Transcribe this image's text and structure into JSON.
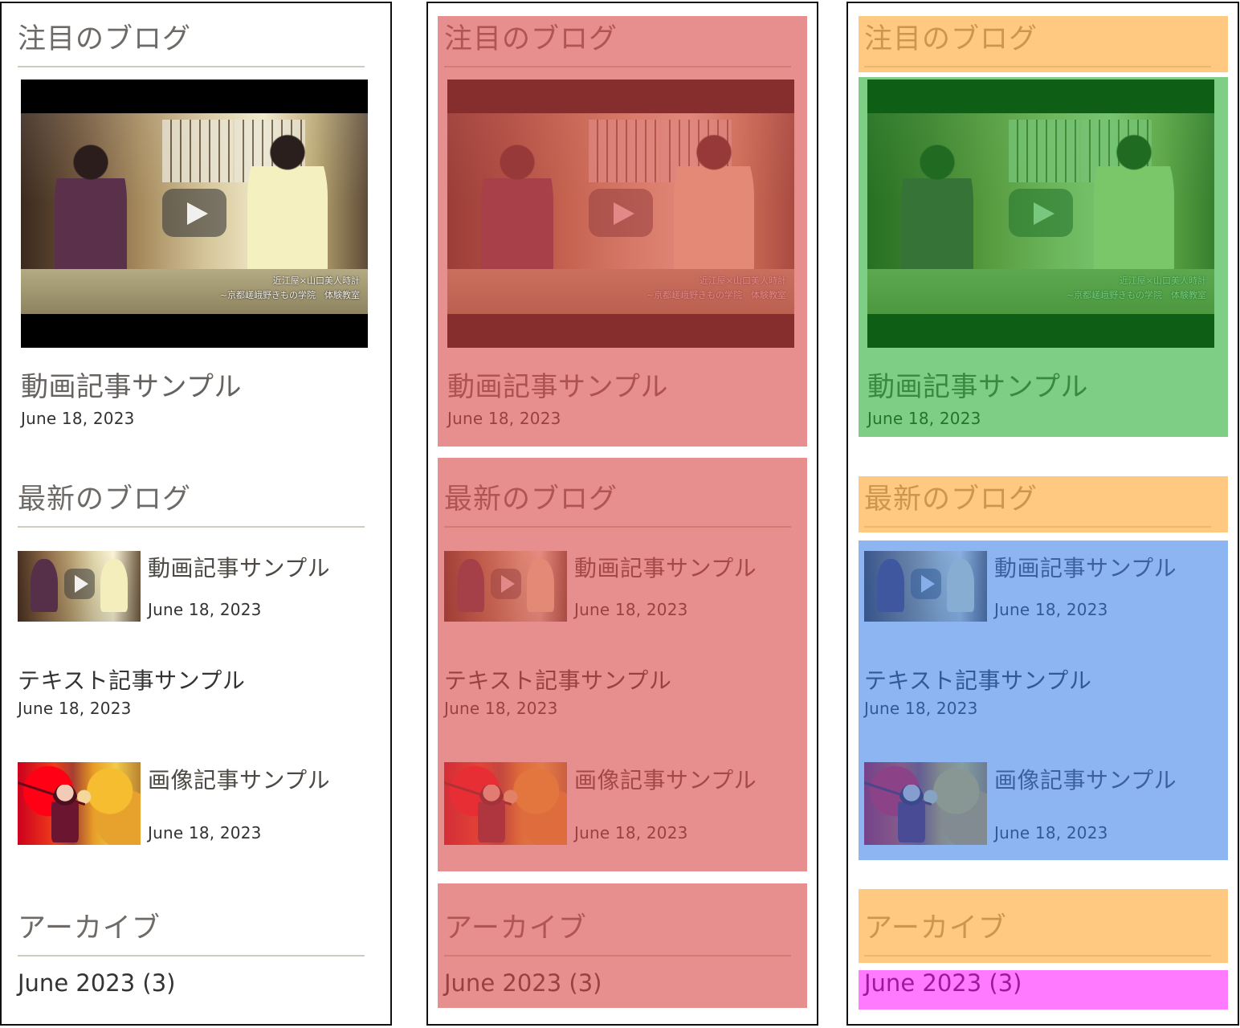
{
  "featured": {
    "heading": "注目のブログ",
    "post_title": "動画記事サンプル",
    "post_date": "June 18, 2023",
    "video_caption_line_1": "近江屋×山口美人時計",
    "video_caption_line_2": "~京都嵯峨野きもの学院　体験教室"
  },
  "recent": {
    "heading": "最新のブログ",
    "posts": [
      {
        "title": "動画記事サンプル",
        "date": "June 18, 2023"
      },
      {
        "title": "テキスト記事サンプル",
        "date": "June 18, 2023"
      },
      {
        "title": "画像記事サンプル",
        "date": "June 18, 2023"
      }
    ]
  },
  "archive": {
    "heading": "アーカイブ",
    "month_link": "June 2023 (3)"
  },
  "overlay_colors": {
    "red": "#d84b48",
    "orange": "#ffad40",
    "green": "#19a827",
    "blue": "#2e78e6",
    "magenta": "#ff00ff"
  }
}
